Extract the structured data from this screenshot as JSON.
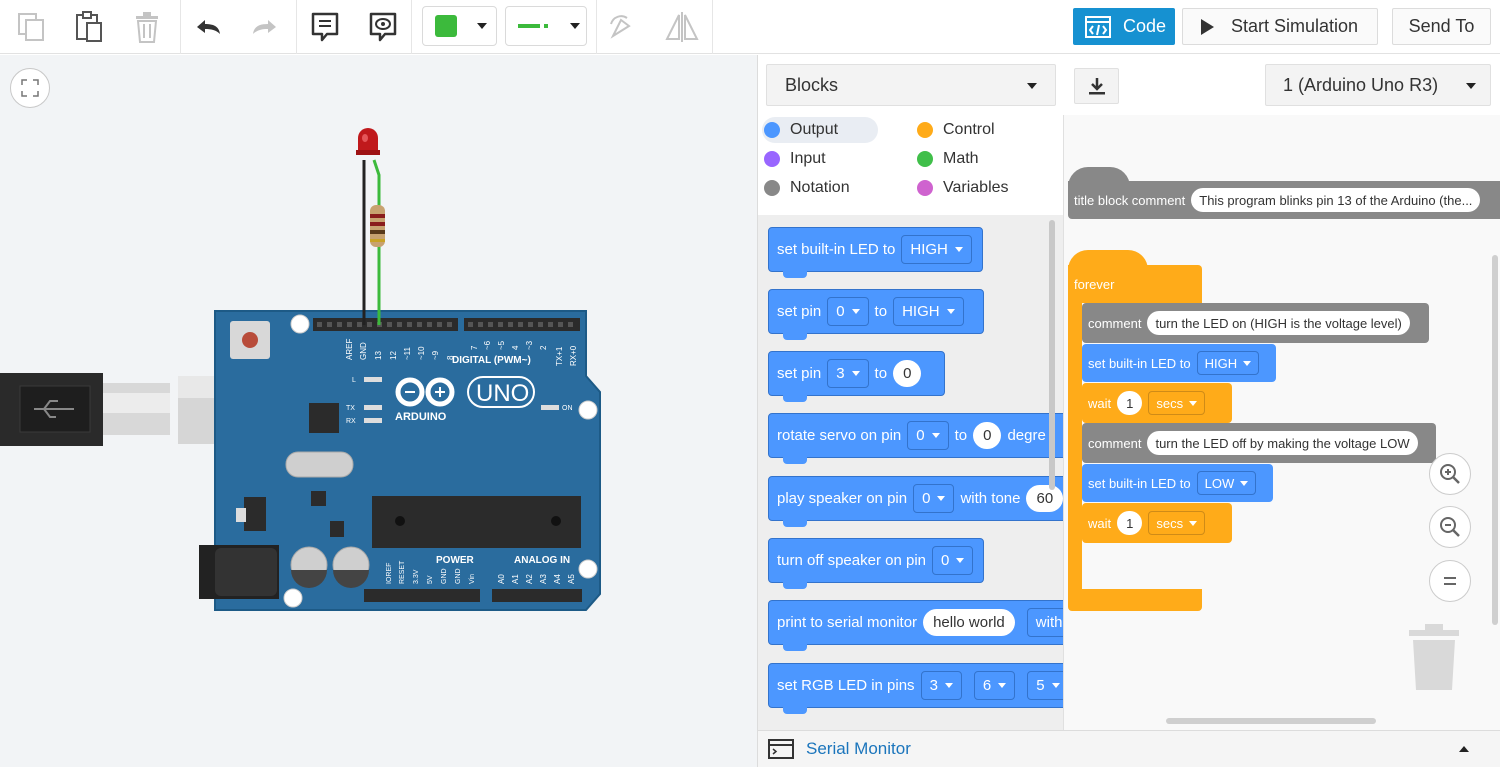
{
  "toolbar": {
    "copy_icon": "copy-icon",
    "paste_icon": "paste-icon",
    "delete_icon": "trash-icon",
    "undo_icon": "undo-icon",
    "redo_icon": "redo-icon",
    "notes_icon": "notes-icon",
    "view_icon": "eye-icon",
    "fill_color": "#3cba3c",
    "wire_color": "#3cba3c",
    "rotate_icon": "rotate-icon",
    "flip_icon": "flip-icon",
    "code_label": "Code",
    "start_sim_label": "Start Simulation",
    "send_to_label": "Send To"
  },
  "canvas": {
    "fit_icon": "fit-view-icon",
    "board": {
      "brand": "ARDUINO",
      "model": "UNO",
      "digital_label": "DIGITAL (PWM~)",
      "power_label": "POWER",
      "analog_label": "ANALOG IN",
      "on_label": "ON",
      "l_label": "L",
      "tx_label": "TX",
      "rx_label": "RX",
      "top_pins": [
        "AREF",
        "GND",
        "13",
        "12",
        "~11",
        "~10",
        "~9",
        "8",
        "7",
        "~6",
        "~5",
        "4",
        "~3",
        "2",
        "TX+1",
        "RX+0"
      ],
      "bottom_pins": [
        "IOREF",
        "RESET",
        "3.3V",
        "5V",
        "GND",
        "GND",
        "Vin",
        "A0",
        "A1",
        "A2",
        "A3",
        "A4",
        "A5"
      ]
    },
    "led_color": "#c0191c"
  },
  "code_panel": {
    "mode_select": "Blocks",
    "board_select": "1 (Arduino Uno R3)",
    "download_icon": "download-icon",
    "categories": [
      {
        "label": "Output",
        "color": "#4c97ff"
      },
      {
        "label": "Control",
        "color": "#ffab19"
      },
      {
        "label": "Input",
        "color": "#9966ff"
      },
      {
        "label": "Math",
        "color": "#40bf4a"
      },
      {
        "label": "Notation",
        "color": "#888888"
      },
      {
        "label": "Variables",
        "color": "#cf63cf"
      }
    ],
    "flyout": {
      "b1": {
        "t1": "set built-in LED to",
        "d1": "HIGH"
      },
      "b2": {
        "t1": "set pin",
        "d1": "0",
        "t2": "to",
        "d2": "HIGH"
      },
      "b3": {
        "t1": "set pin",
        "d1": "3",
        "t2": "to",
        "v1": "0"
      },
      "b4": {
        "t1": "rotate servo on pin",
        "d1": "0",
        "t2": "to",
        "v1": "0",
        "t3": "degre"
      },
      "b5": {
        "t1": "play speaker on pin",
        "d1": "0",
        "t2": "with tone",
        "v1": "60"
      },
      "b6": {
        "t1": "turn off speaker on pin",
        "d1": "0"
      },
      "b7": {
        "t1": "print to serial monitor",
        "v1": "hello world",
        "t2": "with"
      },
      "b8": {
        "t1": "set RGB LED in pins",
        "d1": "3",
        "d2": "6",
        "d3": "5"
      }
    },
    "workspace": {
      "title_comment": {
        "label": "title block comment",
        "text": "This program blinks pin 13 of the Arduino (the..."
      },
      "forever_label": "forever",
      "c1": {
        "label": "comment",
        "text": "turn the LED on (HIGH is the voltage level)"
      },
      "s1": {
        "label": "set built-in LED to",
        "value": "HIGH"
      },
      "w1": {
        "label": "wait",
        "value": "1",
        "unit": "secs"
      },
      "c2": {
        "label": "comment",
        "text": "turn the LED off by making the voltage LOW"
      },
      "s2": {
        "label": "set built-in LED to",
        "value": "LOW"
      },
      "w2": {
        "label": "wait",
        "value": "1",
        "unit": "secs"
      },
      "zoom_in_icon": "zoom-in-icon",
      "zoom_out_icon": "zoom-out-icon",
      "zoom_reset_icon": "zoom-reset-icon",
      "trash_icon": "trash-can-icon"
    },
    "serial_monitor_label": "Serial Monitor",
    "serial_toggle_icon": "caret-up-icon"
  }
}
